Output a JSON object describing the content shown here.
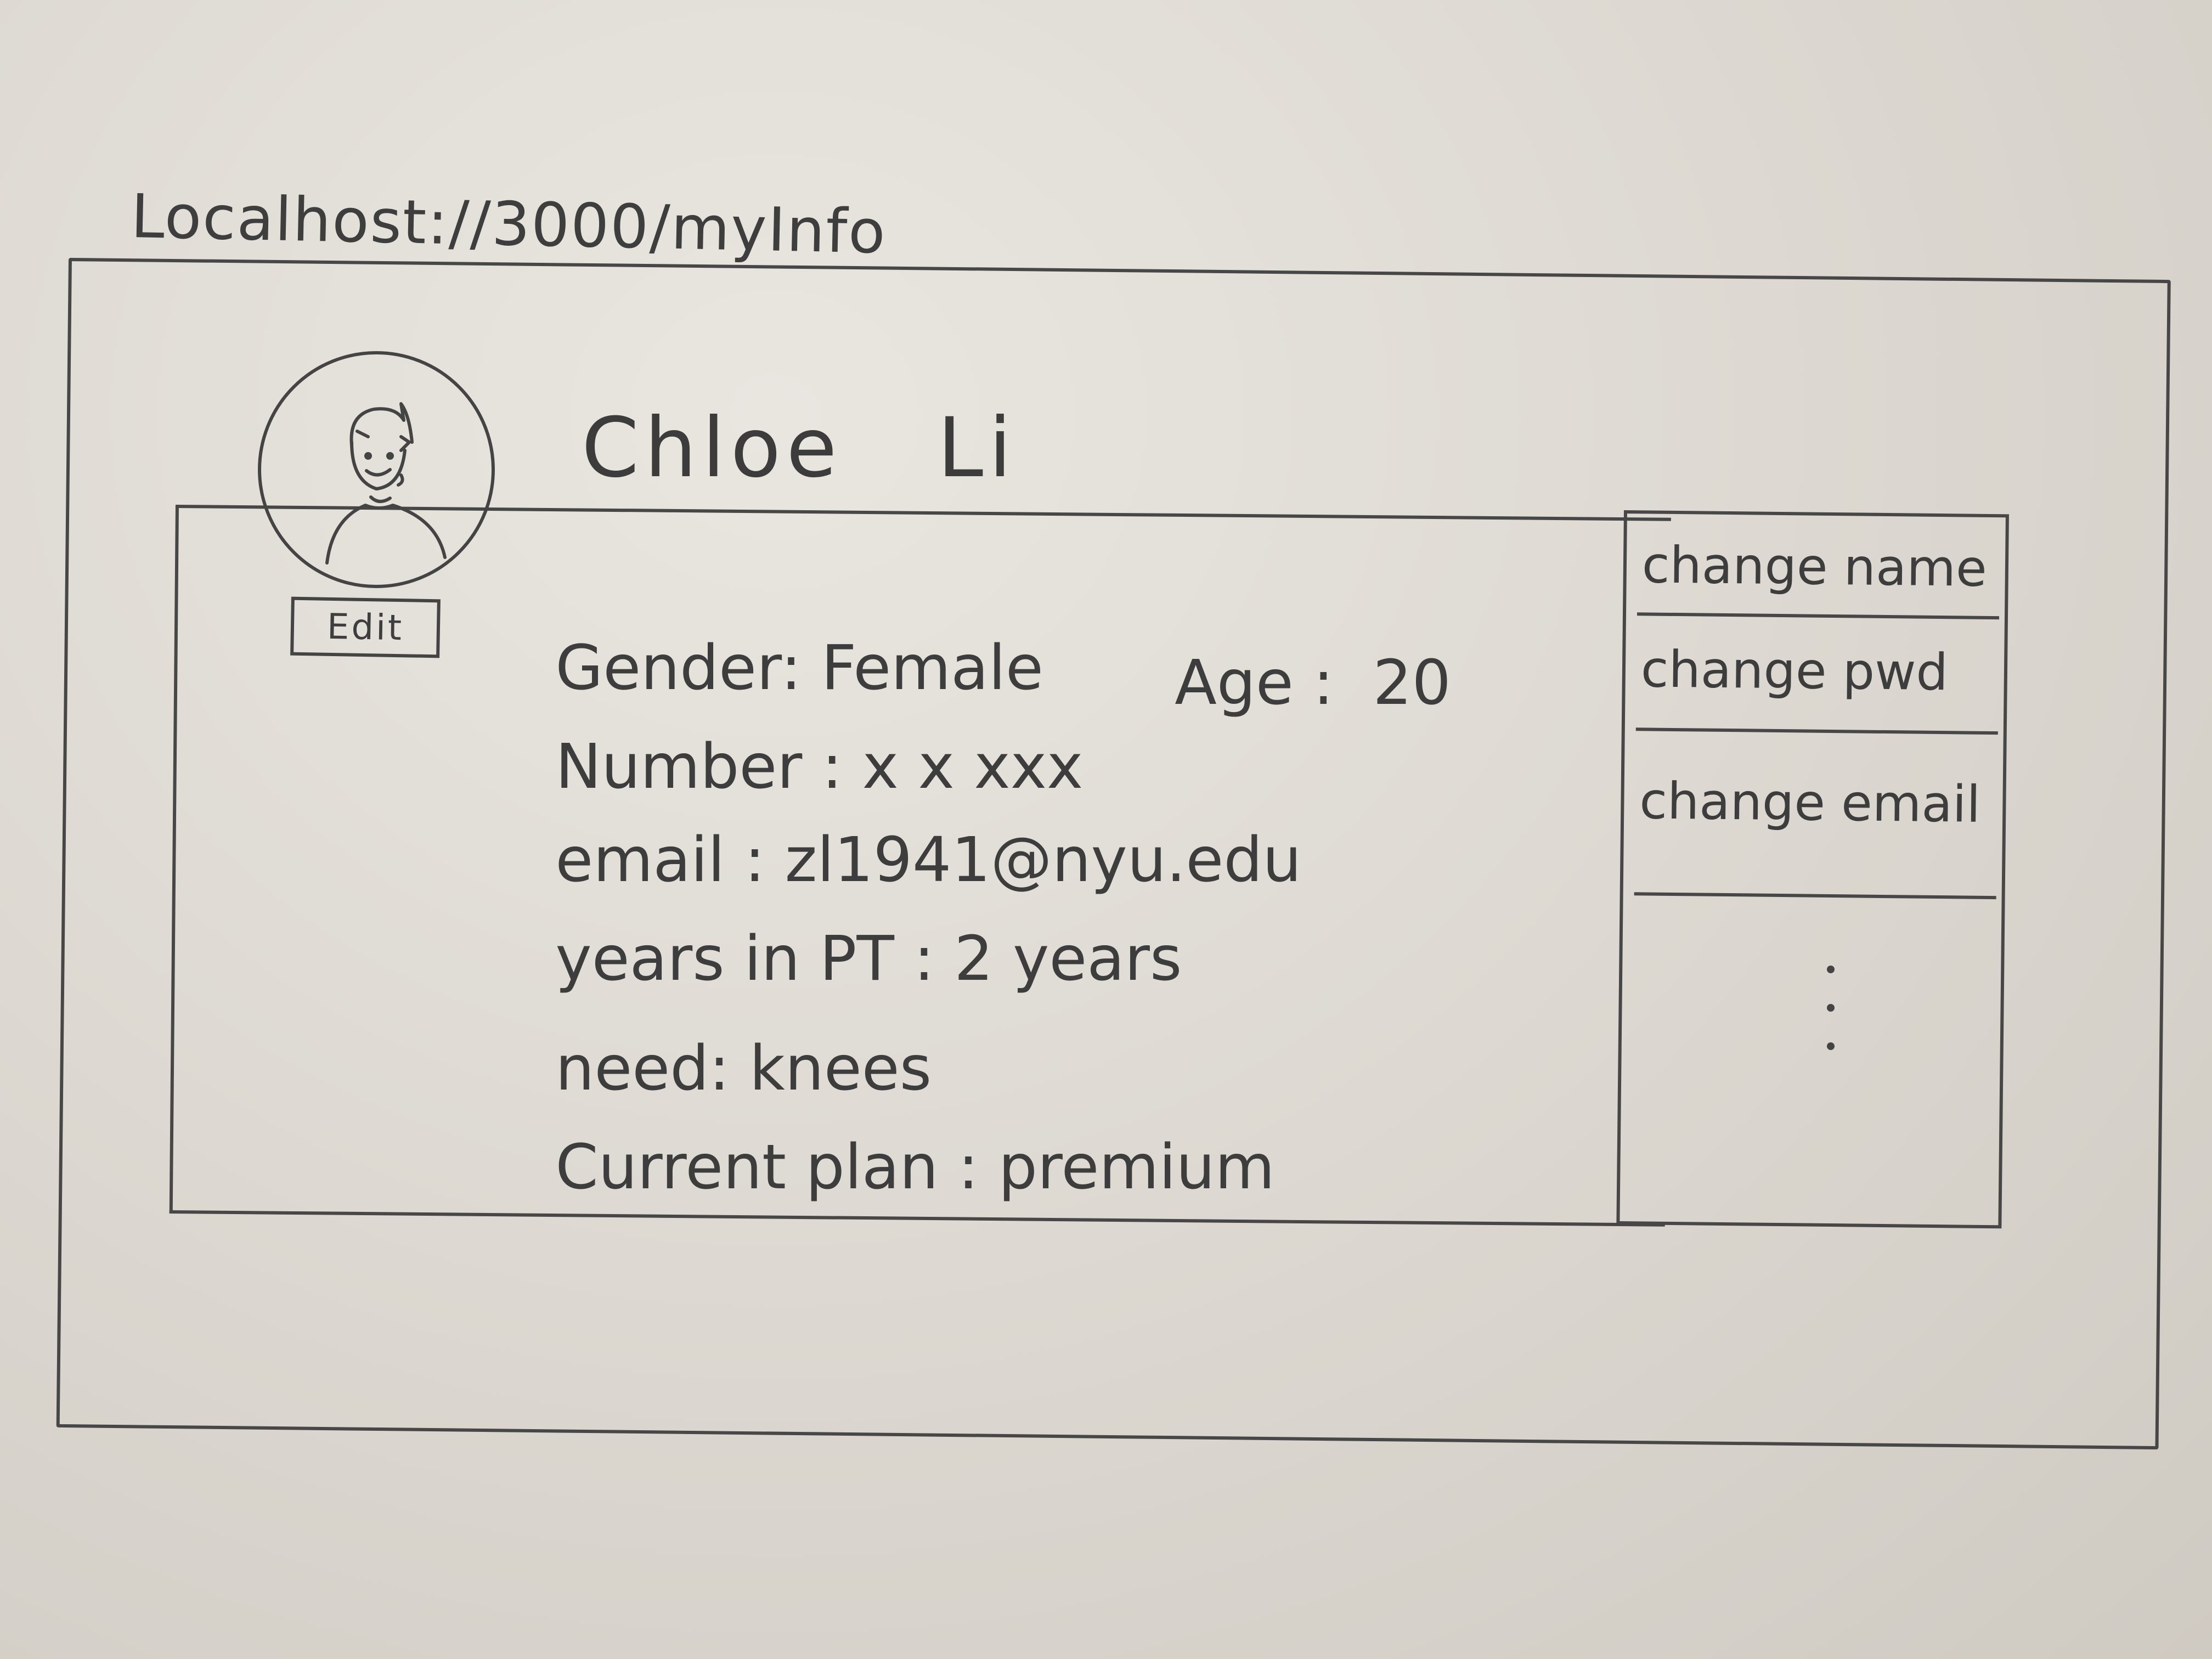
{
  "address_bar": {
    "url": "Localhost://3000/myInfo"
  },
  "profile": {
    "name": "Chloe   Li",
    "edit_label": "Edit",
    "avatar_icon": "user-avatar-icon"
  },
  "fields": {
    "gender": {
      "label": "Gender:",
      "value": "Female"
    },
    "age": {
      "label": "Age :",
      "value": "20"
    },
    "number": {
      "label": "Number :",
      "value": "x x xxx"
    },
    "email": {
      "label": "email :",
      "value": "zl1941@nyu.edu"
    },
    "years_in_pt": {
      "label": "years in PT :",
      "value": "2 years"
    },
    "need": {
      "label": "need:",
      "value": "knees"
    },
    "current_plan": {
      "label": "Current plan :",
      "value": "premium"
    }
  },
  "sidebar": {
    "items": [
      {
        "label": "change name"
      },
      {
        "label": "change pwd"
      },
      {
        "label": "change email"
      }
    ],
    "more_icon": "vertical-ellipsis-icon"
  }
}
